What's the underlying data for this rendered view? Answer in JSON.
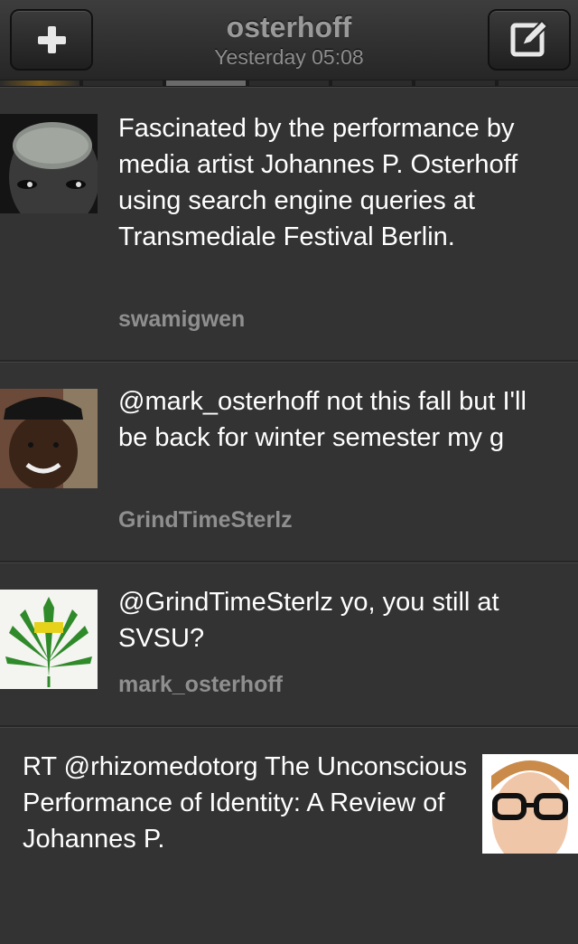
{
  "header": {
    "title": "osterhoff",
    "subtitle": "Yesterday 05:08",
    "add_icon": "plus-icon",
    "compose_icon": "compose-icon"
  },
  "colors": {
    "background": "#333333",
    "text": "#ffffff",
    "author": "#8f8f8f",
    "navbar": "#2e2e2e"
  },
  "tweets": [
    {
      "text": "Fascinated by the performance by media artist Johannes P. Osterhoff using search engine queries at Transmediale Festival Berlin.",
      "author": "swamigwen",
      "avatar": "woman-face-avatar"
    },
    {
      "text": "@mark_osterhoff not this fall but I'll be back for winter semester my g",
      "author": "GrindTimeSterlz",
      "avatar": "man-cap-avatar"
    },
    {
      "text": "@GrindTimeSterlz yo, you still at SVSU?",
      "author": "mark_osterhoff",
      "avatar": "leaf-logo-avatar"
    },
    {
      "text": "RT @rhizomedotorg The Unconscious Performance of Identity: A Review of Johannes P.",
      "author": "",
      "avatar": "glasses-man-avatar"
    }
  ]
}
